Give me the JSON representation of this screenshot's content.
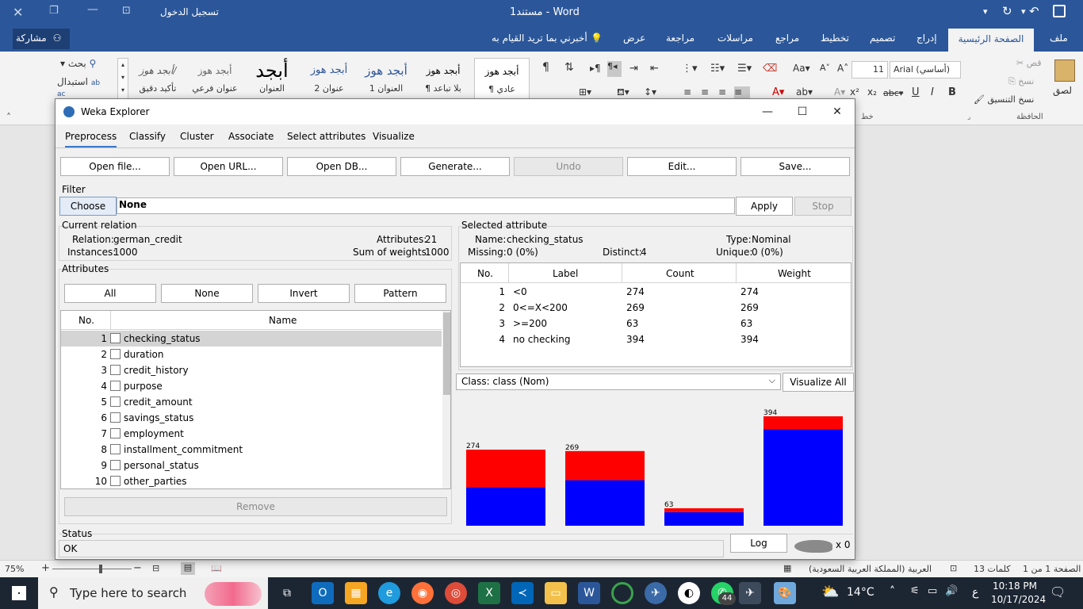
{
  "word": {
    "title": "مستند1 - Word",
    "signin": "تسجيل الدخول",
    "share": "مشاركة",
    "tabs": [
      "ملف",
      "الصفحة الرئيسية",
      "إدراج",
      "تصميم",
      "تخطيط",
      "مراجع",
      "مراسلات",
      "مراجعة",
      "عرض"
    ],
    "tell_me": "أخبرني بما تريد القيام به",
    "clipboard": {
      "paste": "لصق",
      "cut": "قص",
      "copy": "نسخ",
      "format_painter": "نسخ التنسيق",
      "group": "الحافظة"
    },
    "font": {
      "name": "Arial (أساسي)",
      "size": "11",
      "group": "خط"
    },
    "styles": [
      {
        "sample": "أبجد هوز",
        "label": "¶ عادي"
      },
      {
        "sample": "أبجد هوز",
        "label": "¶ بلا تباعد"
      },
      {
        "sample": "أبجد هوز",
        "label": "العنوان 1"
      },
      {
        "sample": "أبجد هوز",
        "label": "عنوان 2"
      },
      {
        "sample": "أبجد",
        "label": "العنوان"
      },
      {
        "sample": "أبجد هوز",
        "label": "عنوان فرعي"
      },
      {
        "sample": "أبجد هوز/",
        "label": "تأكيد دقيق"
      }
    ],
    "editing": {
      "find": "بحث",
      "replace": "استبدال"
    },
    "status": {
      "page": "الصفحة 1 من 1",
      "words": "13 كلمات",
      "language": "العربية (المملكة العربية السعودية)",
      "zoom": "75%"
    }
  },
  "weka": {
    "title": "Weka Explorer",
    "tabs": [
      "Preprocess",
      "Classify",
      "Cluster",
      "Associate",
      "Select attributes",
      "Visualize"
    ],
    "toolbar": [
      "Open file...",
      "Open URL...",
      "Open DB...",
      "Generate...",
      "Undo",
      "Edit...",
      "Save..."
    ],
    "filter": {
      "label": "Filter",
      "choose": "Choose",
      "value": "None",
      "apply": "Apply",
      "stop": "Stop"
    },
    "current_relation": {
      "title": "Current relation",
      "relation_label": "Relation:",
      "relation": "german_credit",
      "instances_label": "Instances:",
      "instances": "1000",
      "attributes_label": "Attributes:",
      "attributes": "21",
      "weights_label": "Sum of weights:",
      "weights": "1000"
    },
    "attributes": {
      "title": "Attributes",
      "buttons": [
        "All",
        "None",
        "Invert",
        "Pattern"
      ],
      "headers": [
        "No.",
        "Name"
      ],
      "rows": [
        {
          "no": "1",
          "name": "checking_status"
        },
        {
          "no": "2",
          "name": "duration"
        },
        {
          "no": "3",
          "name": "credit_history"
        },
        {
          "no": "4",
          "name": "purpose"
        },
        {
          "no": "5",
          "name": "credit_amount"
        },
        {
          "no": "6",
          "name": "savings_status"
        },
        {
          "no": "7",
          "name": "employment"
        },
        {
          "no": "8",
          "name": "installment_commitment"
        },
        {
          "no": "9",
          "name": "personal_status"
        },
        {
          "no": "10",
          "name": "other_parties"
        }
      ],
      "remove": "Remove"
    },
    "selected_attribute": {
      "title": "Selected attribute",
      "name_label": "Name:",
      "name": "checking_status",
      "type_label": "Type:",
      "type": "Nominal",
      "missing_label": "Missing:",
      "missing": "0 (0%)",
      "distinct_label": "Distinct:",
      "distinct": "4",
      "unique_label": "Unique:",
      "unique": "0 (0%)",
      "headers": [
        "No.",
        "Label",
        "Count",
        "Weight"
      ],
      "rows": [
        {
          "no": "1",
          "label": "<0",
          "count": "274",
          "weight": "274"
        },
        {
          "no": "2",
          "label": "0<=X<200",
          "count": "269",
          "weight": "269"
        },
        {
          "no": "3",
          "label": ">=200",
          "count": "63",
          "weight": "63"
        },
        {
          "no": "4",
          "label": "no checking",
          "count": "394",
          "weight": "394"
        }
      ]
    },
    "class_select": "Class: class (Nom)",
    "visualize_all": "Visualize All",
    "status": {
      "title": "Status",
      "text": "OK",
      "log": "Log",
      "count": "x 0"
    }
  },
  "chart_data": {
    "type": "bar",
    "categories": [
      "<0",
      "0<=X<200",
      ">=200",
      "no checking"
    ],
    "series": [
      {
        "values": [
          139,
          164,
          49,
          348
        ],
        "color": "#0000ff"
      },
      {
        "values": [
          135,
          105,
          14,
          46
        ],
        "color": "#ff0000"
      }
    ],
    "data_labels": [
      "274",
      "269",
      "63",
      "394"
    ],
    "ylim": [
      0,
      394
    ]
  },
  "taskbar": {
    "search": "Type here to search",
    "weather": "14°C",
    "lang": "ع",
    "time": "10:18 PM",
    "date": "10/17/2024",
    "whatsapp_badge": "44"
  }
}
